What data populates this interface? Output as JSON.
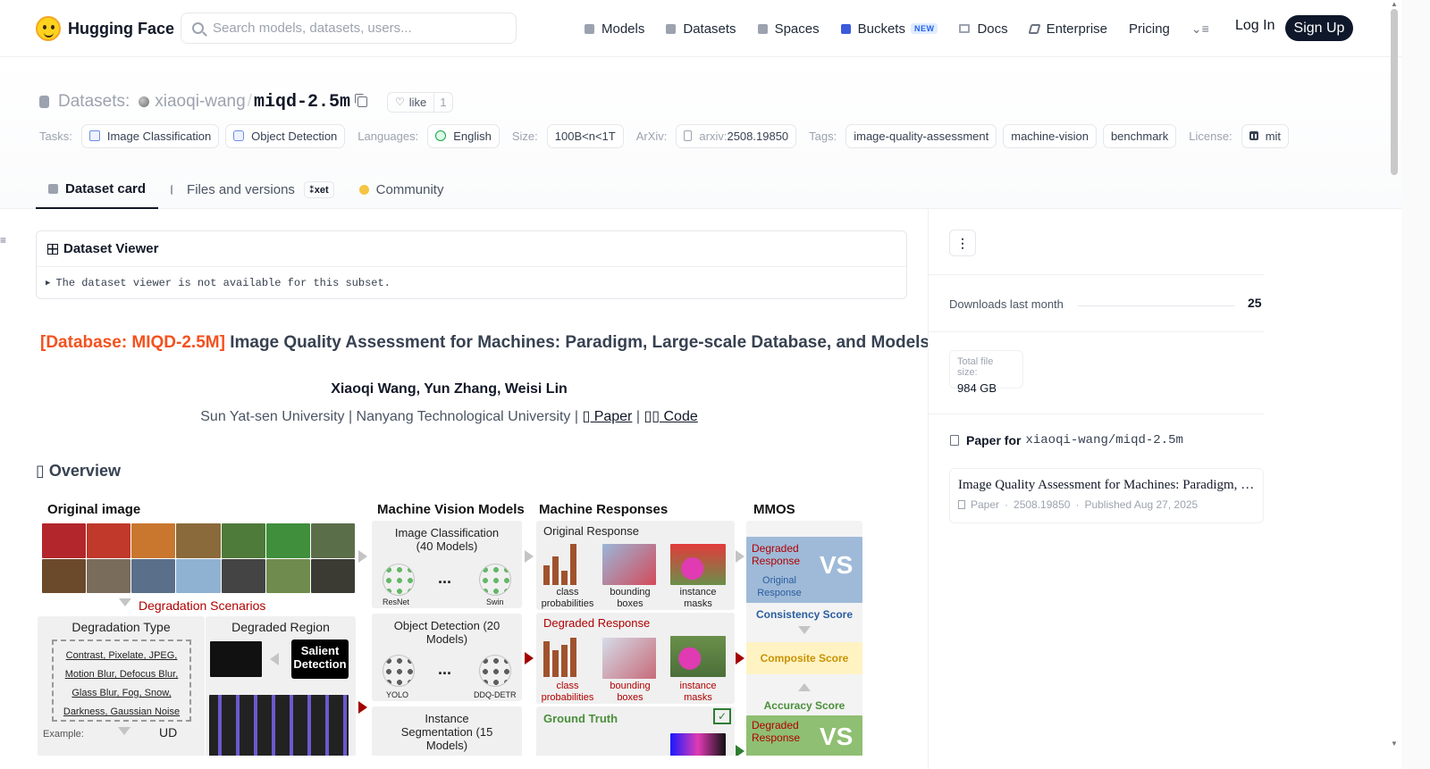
{
  "header": {
    "brand": "Hugging Face",
    "search_placeholder": "Search models, datasets, users...",
    "nav": [
      {
        "label": "Models"
      },
      {
        "label": "Datasets"
      },
      {
        "label": "Spaces"
      },
      {
        "label": "Buckets",
        "badge": "NEW"
      },
      {
        "label": "Docs"
      },
      {
        "label": "Enterprise"
      },
      {
        "label": "Pricing"
      }
    ],
    "login": "Log In",
    "signup": "Sign Up"
  },
  "dataset": {
    "section_label": "Datasets:",
    "owner": "xiaoqi-wang",
    "separator": "/",
    "name": "miqd-2.5m",
    "like_label": "like",
    "like_count": "1",
    "tasks_label": "Tasks:",
    "tasks": [
      "Image Classification",
      "Object Detection"
    ],
    "languages_label": "Languages:",
    "language": "English",
    "size_label": "Size:",
    "size": "100B<n<1T",
    "arxiv_label": "ArXiv:",
    "arxiv_prefix": "arxiv:",
    "arxiv_id": "2508.19850",
    "tags_label": "Tags:",
    "tags": [
      "image-quality-assessment",
      "machine-vision",
      "benchmark"
    ],
    "license_label": "License:",
    "license": "mit"
  },
  "tabs": {
    "card": "Dataset card",
    "files": "Files and versions",
    "xet": "xet",
    "community": "Community"
  },
  "viewer": {
    "title": "Dataset Viewer",
    "message": "The dataset viewer is not available for this subset."
  },
  "card": {
    "title_highlight": "[Database: MIQD-2.5M]",
    "title_rest": " Image Quality Assessment for Machines: Paradigm, Large-scale Database, and Models",
    "authors": "Xiaoqi Wang, Yun Zhang, Weisi Lin",
    "affiliations": "Sun Yat-sen University | Nanyang Technological University | ",
    "paper_link": "▯ Paper",
    "link_sep": " | ",
    "code_link": "▯▯ Code",
    "overview": "▯ Overview"
  },
  "figure": {
    "h_original": "Original image",
    "h_models": "Machine Vision Models",
    "h_responses": "Machine Responses",
    "h_mmos": "MMOS",
    "degradation_scenarios": "Degradation Scenarios",
    "degradation_type": "Degradation Type",
    "degraded_region": "Degraded Region",
    "degradation_list": "Contrast, Pixelate, JPEG, Motion Blur, Defocus Blur, Glass Blur, Fog, Snow, Darkness, Gaussian Noise",
    "salient_detection": "Salient Detection",
    "example": "Example:",
    "ud": "UD",
    "image_classification": "Image Classification (40 Models)",
    "object_detection": "Object Detection (20 Models)",
    "instance_segmentation": "Instance Segmentation (15 Models)",
    "resnet": "ResNet",
    "swin": "Swin",
    "yolo": "YOLO",
    "ddqdetr": "DDQ-DETR",
    "ellipsis": "...",
    "original_response": "Original Response",
    "degraded_response": "Degraded Response",
    "ground_truth": "Ground Truth",
    "class_probabilities": "class probabilities",
    "bounding_boxes": "bounding boxes",
    "instance_masks": "instance masks",
    "mmos_degraded": "Degraded Response",
    "mmos_original": "Original Response",
    "vs": "VS",
    "consistency_score": "Consistency Score",
    "composite_score": "Composite Score",
    "accuracy_score": "Accuracy Score"
  },
  "sidebar": {
    "downloads_label": "Downloads last month",
    "downloads_value": "25",
    "file_size_label": "Total file size:",
    "file_size_value": "984 GB",
    "paper_for_label": "Paper for",
    "paper_for_repo": "xiaoqi-wang/miqd-2.5m",
    "paper_title": "Image Quality Assessment for Machines: Paradigm, Large-scale Database, and Models",
    "paper_type": "Paper",
    "paper_id": "2508.19850",
    "paper_published": "Published Aug 27, 2025"
  }
}
